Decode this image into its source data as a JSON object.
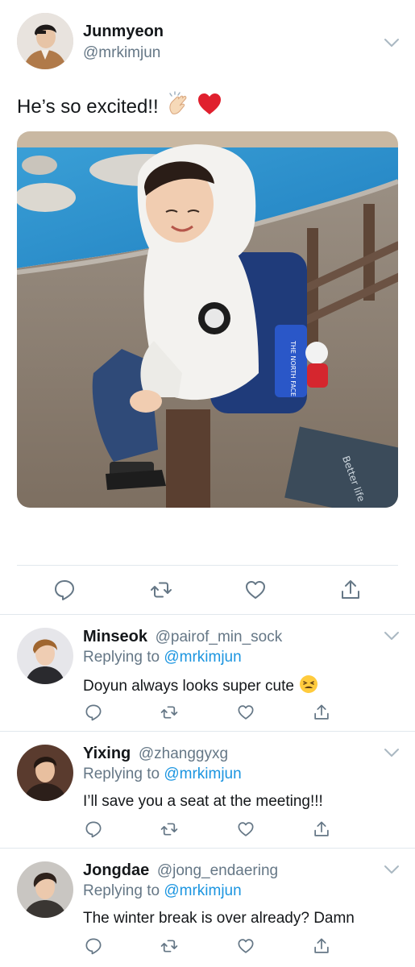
{
  "main_tweet": {
    "display_name": "Junmyeon",
    "handle": "@mrkimjun",
    "text": "He’s so excited!!",
    "emojis": [
      "clapping-hands-emoji",
      "red-heart-emoji"
    ],
    "media_text": [
      "THE NORTH FACE",
      "Better life",
      "Better"
    ],
    "actions": [
      "reply-icon",
      "retweet-icon",
      "like-icon",
      "share-icon"
    ]
  },
  "replies": [
    {
      "display_name": "Minseok",
      "handle": "@pairof_min_sock",
      "replying_prefix": "Replying to",
      "replying_to": "@mrkimjun",
      "text": "Doyun always looks super cute",
      "emoji": "tired-face-emoji"
    },
    {
      "display_name": "Yixing",
      "handle": "@zhanggyxg",
      "replying_prefix": "Replying to",
      "replying_to": "@mrkimjun",
      "text": "I’ll save you a seat at the meeting!!!"
    },
    {
      "display_name": "Jongdae",
      "handle": "@jong_endaering",
      "replying_prefix": "Replying to",
      "replying_to": "@mrkimjun",
      "text": "The winter break is over already? Damn"
    }
  ],
  "colors": {
    "text": "#14171a",
    "secondary": "#657786",
    "link": "#1b95e0",
    "divider": "#e1e8ed",
    "heart_emoji": "#e0245e"
  }
}
